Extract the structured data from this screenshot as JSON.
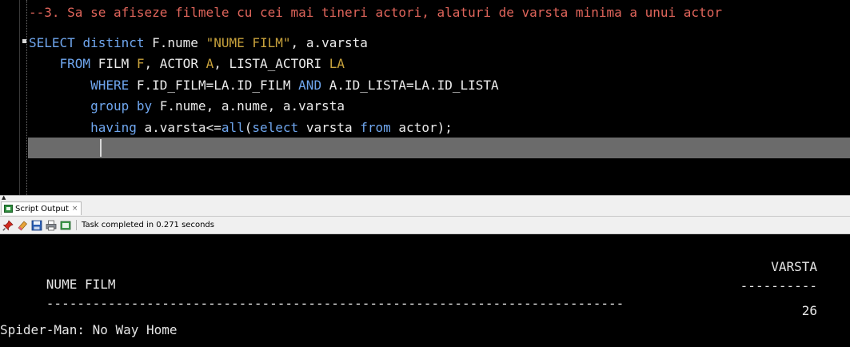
{
  "editor": {
    "lines": {
      "l1": {
        "comment": "--3. Sa se afiseze filmele cu cei mai tineri actori, alaturi de varsta minima a unui actor"
      },
      "l2": {
        "kw_select": "SELECT",
        "kw_distinct": "distinct",
        "col1": "F.nume",
        "alias_str": "\"NUME FILM\"",
        "col2": ", a.varsta"
      },
      "l3": {
        "kw_from": "FROM",
        "t1": "FILM",
        "a1": "F",
        "t2": ", ACTOR",
        "a2": "A",
        "t3": ", LISTA_ACTORI",
        "a3": "LA"
      },
      "l4": {
        "kw_where": "WHERE",
        "c1": "F.ID_FILM=LA.ID_FILM",
        "kw_and": "AND",
        "c2": "A.ID_LISTA=LA.ID_LISTA"
      },
      "l5": {
        "kw_group": "group by",
        "cols": "F.nume, a.nume, a.varsta"
      },
      "l6": {
        "kw_having": "having",
        "cond": "a.varsta<=",
        "kw_all": "all",
        "p_open": "(",
        "kw_select": "select",
        "col": "varsta",
        "kw_from": "from",
        "tail": "actor);"
      }
    }
  },
  "output": {
    "tab_label": "Script Output",
    "tab_close": "×",
    "status": "Task completed in 0.271 seconds",
    "toolbar_icons": [
      "pin-icon",
      "eraser-icon",
      "save-icon",
      "print-icon",
      "open-file-icon"
    ],
    "results": {
      "header_left": "NUME FILM",
      "header_right": "VARSTA",
      "sep_left": "---------------------------------------------------------------------------",
      "sep_right": "----------",
      "rows": [
        {
          "varsta": "26",
          "nume_film": "Spider-Man: No Way Home"
        }
      ]
    }
  },
  "colors": {
    "keyword": "#6fa6ee",
    "comment": "#e0655b",
    "string": "#c8a23c",
    "current_line": "#6b6b6b"
  }
}
